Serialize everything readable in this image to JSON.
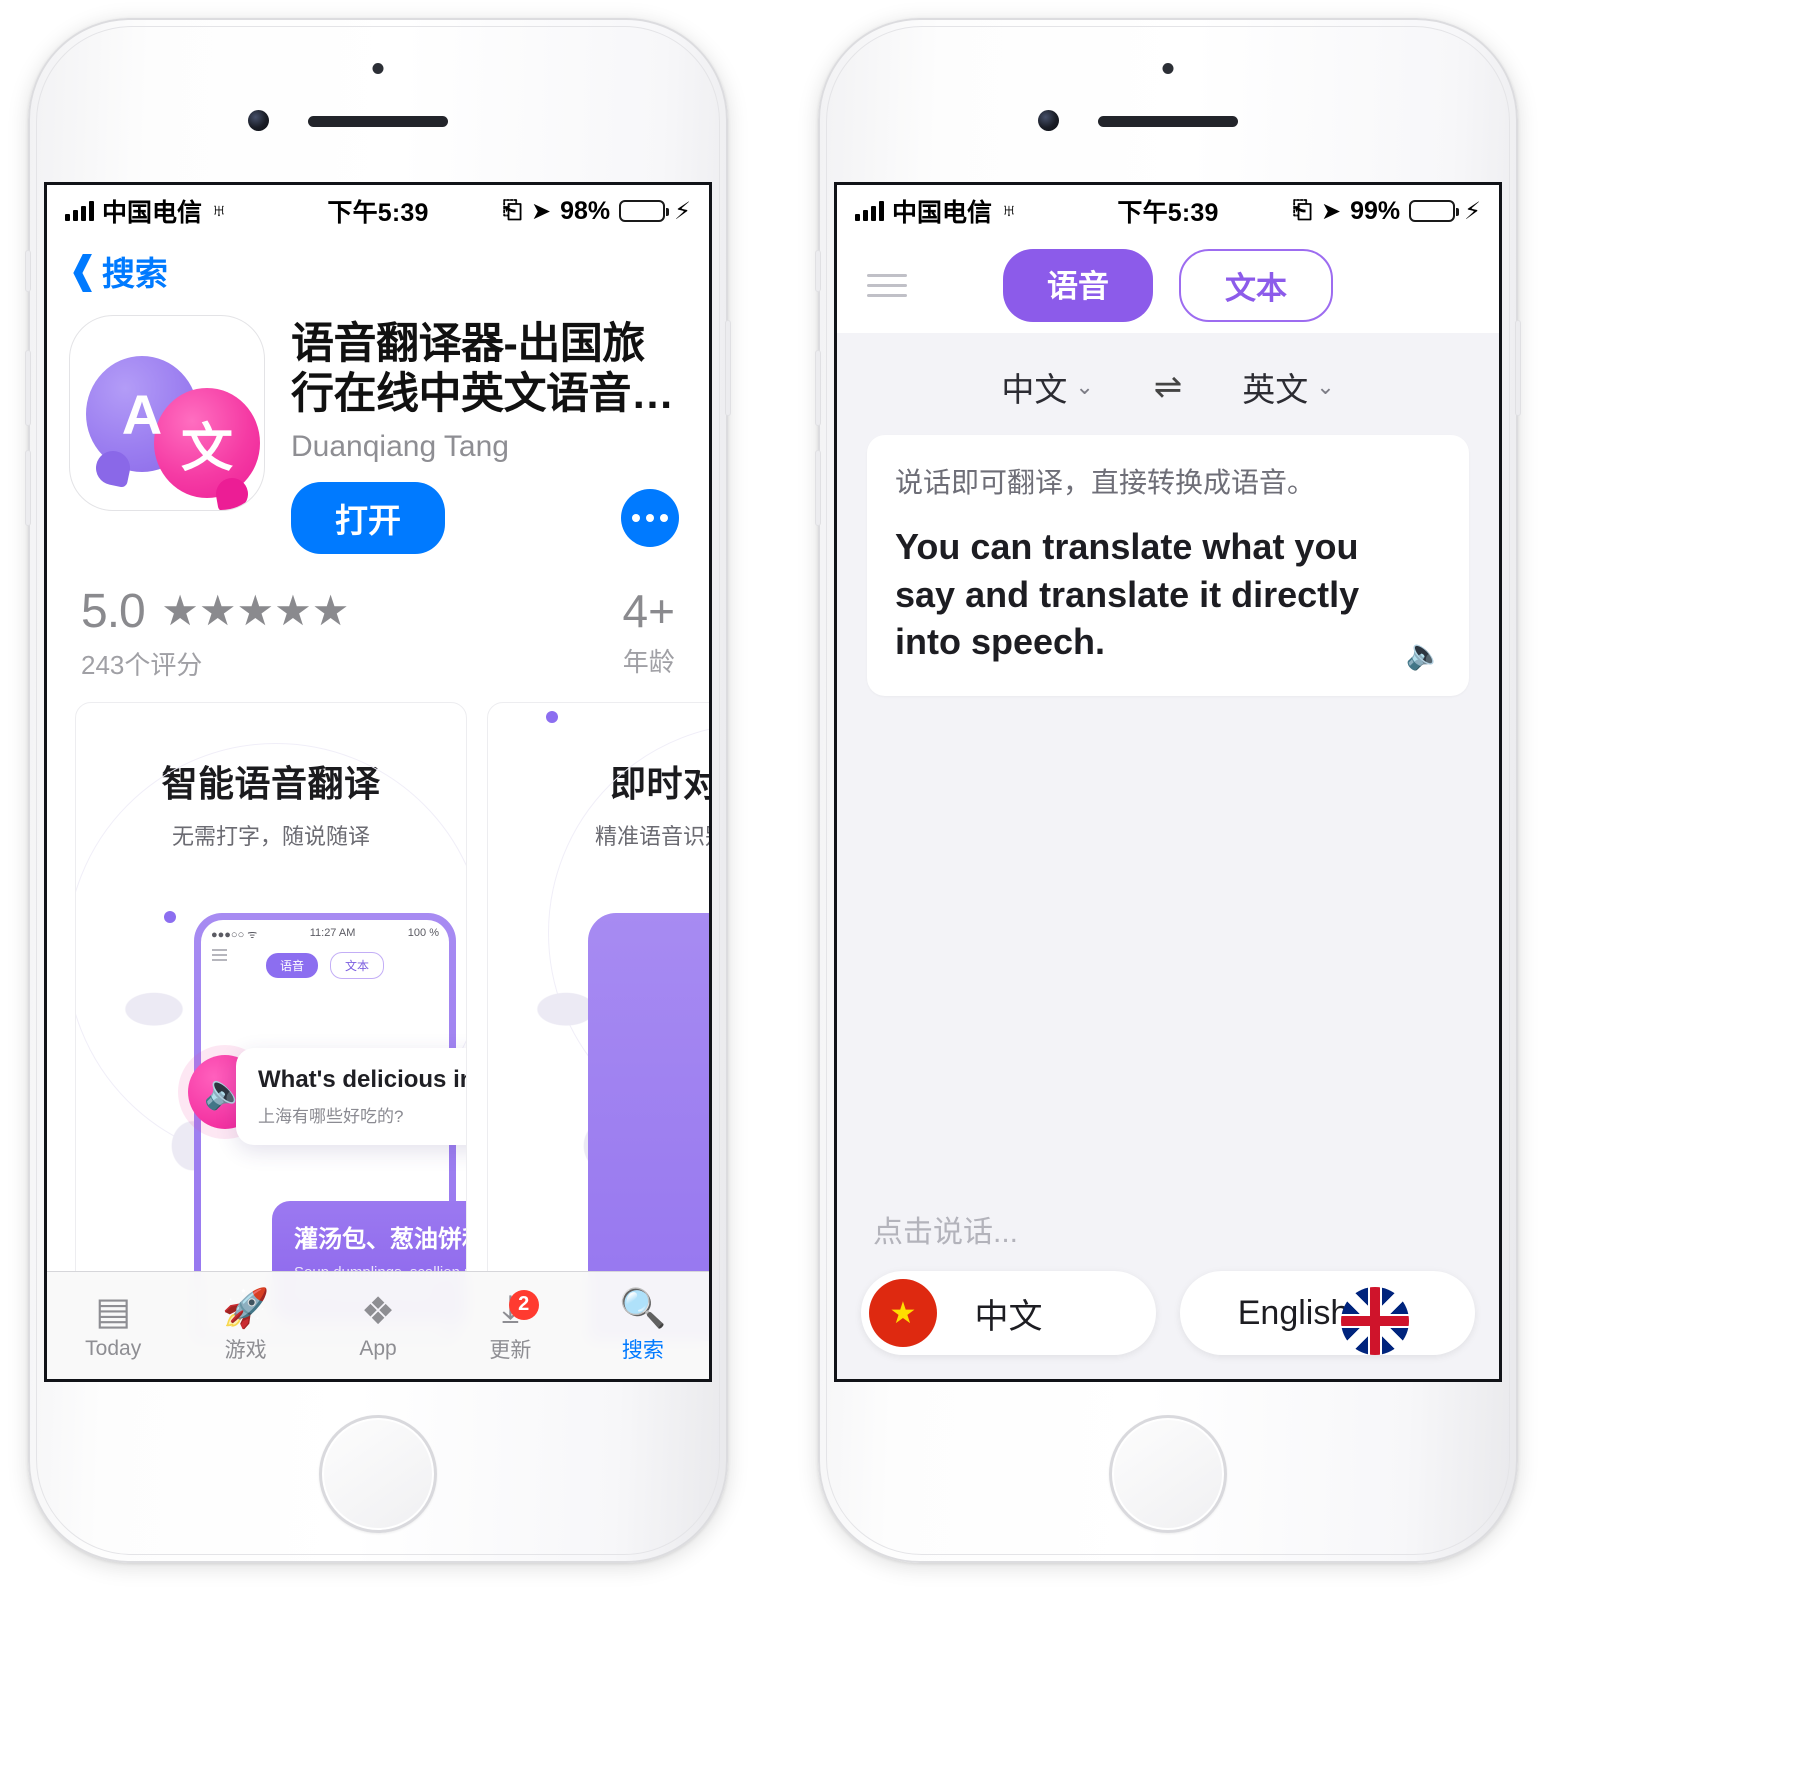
{
  "left_phone": {
    "statusbar": {
      "carrier": "中国电信",
      "time": "下午5:39",
      "battery_pct": "98%"
    },
    "nav": {
      "back_label": "搜索"
    },
    "app": {
      "icon_letter_a": "A",
      "icon_letter_cn": "文",
      "title": "语音翻译器-出国旅行在线中英文语音…",
      "developer": "Duanqiang Tang",
      "open_button": "打开"
    },
    "rating": {
      "score": "5.0",
      "stars": "★★★★★",
      "count": "243个评分",
      "age_value": "4+",
      "age_label": "年龄"
    },
    "screenshots": [
      {
        "title": "智能语音翻译",
        "subtitle": "无需打字，随说随译",
        "mini_status_left": "●●●○○ ᯤ",
        "mini_status_time": "11:27 AM",
        "mini_status_right": "100 %",
        "mini_tab_voice": "语音",
        "mini_tab_text": "文本",
        "bubble_en": "What's delicious in Shanghai?",
        "bubble_cn": "上海有哪些好吃的?",
        "card_cn": "灌汤包、葱油饼和其他好吃的。",
        "card_en": "Soup dumplings, scallion pancakes and other delicious foods."
      },
      {
        "title": "即时对话",
        "subtitle": "精准语音识别，流"
      }
    ],
    "tabbar": [
      {
        "label": "Today",
        "icon": "today-icon",
        "glyph": "▤",
        "badge": ""
      },
      {
        "label": "游戏",
        "icon": "games-rocket-icon",
        "glyph": "🚀",
        "badge": ""
      },
      {
        "label": "App",
        "icon": "apps-stack-icon",
        "glyph": "❖",
        "badge": ""
      },
      {
        "label": "更新",
        "icon": "updates-download-icon",
        "glyph": "⤓",
        "badge": "2"
      },
      {
        "label": "搜索",
        "icon": "search-icon",
        "glyph": "🔍",
        "badge": ""
      }
    ]
  },
  "right_phone": {
    "statusbar": {
      "carrier": "中国电信",
      "time": "下午5:39",
      "battery_pct": "99%"
    },
    "header": {
      "menu_icon": "hamburger-icon",
      "tab_voice": "语音",
      "tab_text": "文本"
    },
    "languages": {
      "source": "中文",
      "target": "英文",
      "swap_glyph": "⇌",
      "chevron": "⌄"
    },
    "translation": {
      "source_text": "说话即可翻译，直接转换成语音。",
      "result_text": "You can translate what you say and translate it directly into speech.",
      "speaker_icon": "speaker-icon"
    },
    "footer": {
      "hint": "点击说话...",
      "button_cn": "中文",
      "button_en": "English",
      "flag_cn_glyph": "★",
      "flag_cn": "cn-flag-icon",
      "flag_uk": "uk-flag-icon"
    }
  },
  "colors": {
    "ios_blue": "#007aff",
    "purple": "#8c5bea",
    "pink": "#ec1d95",
    "badge_red": "#ff3b30",
    "battery_green": "#4cd964"
  }
}
